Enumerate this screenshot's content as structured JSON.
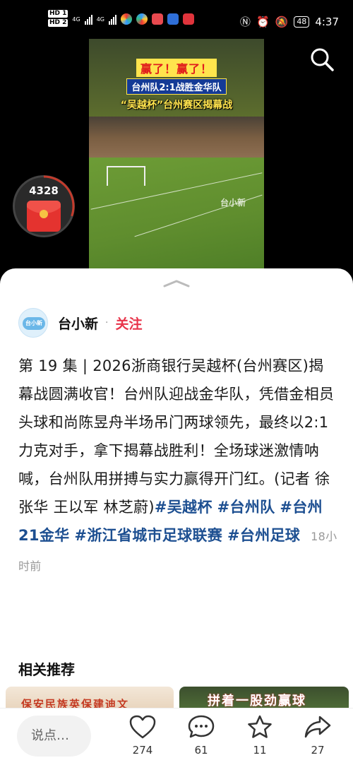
{
  "status_bar": {
    "hd1": "HD 1",
    "hd2": "HD 2",
    "net1": "4G",
    "net2": "4G",
    "battery": "48",
    "time": "4:37"
  },
  "video": {
    "headline_1": "赢了！赢了！",
    "headline_2": "台州队2:1战胜金华队",
    "headline_3": "“吴越杯”台州赛区揭幕战",
    "watermark": "台小新"
  },
  "red_packet": {
    "count": "4328"
  },
  "author": {
    "name": "台小新",
    "avatar_text": "台小新",
    "follow_label": "关注"
  },
  "post": {
    "text": "第 19 集 | 2026浙商银行吴越杯(台州赛区)揭幕战圆满收官！台州队迎战金华队，凭借金相员头球和尚陈昱舟半场吊门两球领先，最终以2:1力克对手，拿下揭幕战胜利！全场球迷激情呐喊，台州队用拼搏与实力赢得开门红。(记者 徐张华 王以军 林芝蔚)",
    "tags": [
      "#吴越杯",
      "#台州队",
      "#台州21金华",
      "#浙江省城市足球联赛",
      "#台州足球"
    ],
    "time": "18小时前"
  },
  "related": {
    "title": "相关推荐",
    "thumb1_text": "保安民族英保建迪文",
    "thumb2_text": "拼着一股劲赢球"
  },
  "bottom_bar": {
    "comment_placeholder": "说点…",
    "likes": "274",
    "comments": "61",
    "favorites": "11",
    "shares": "27"
  }
}
